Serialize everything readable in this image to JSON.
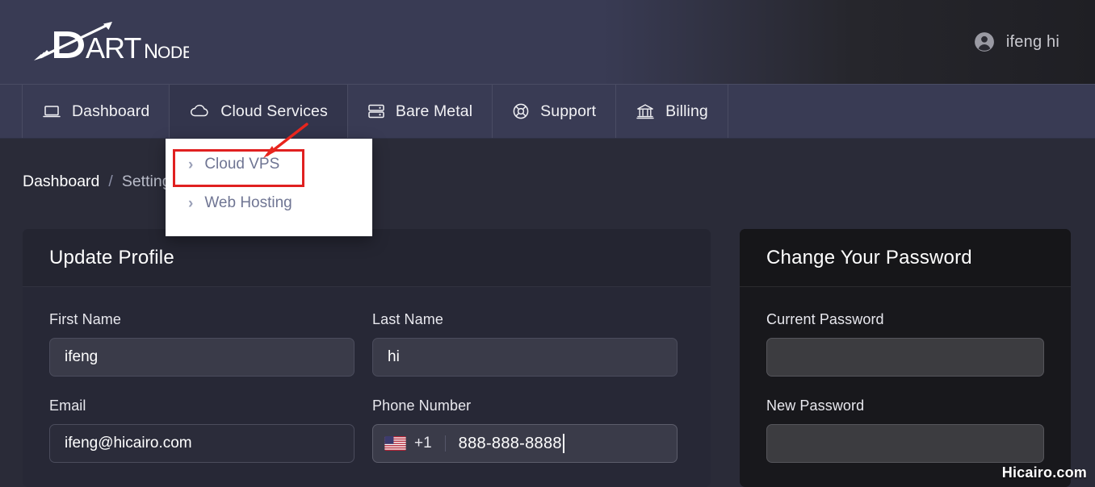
{
  "header": {
    "logo_text_main": "ART",
    "logo_text_sub": "NODE",
    "logo_alt": "DartNode",
    "user_name": "ifeng hi"
  },
  "nav": {
    "items": [
      {
        "label": "Dashboard",
        "icon": "laptop-icon",
        "active": false
      },
      {
        "label": "Cloud Services",
        "icon": "cloud-icon",
        "active": true
      },
      {
        "label": "Bare Metal",
        "icon": "server-icon",
        "active": false
      },
      {
        "label": "Support",
        "icon": "lifering-icon",
        "active": false
      },
      {
        "label": "Billing",
        "icon": "bank-icon",
        "active": false
      }
    ]
  },
  "dropdown": {
    "items": [
      {
        "label": "Cloud VPS",
        "highlighted": true
      },
      {
        "label": "Web Hosting",
        "highlighted": false
      }
    ],
    "chevron": "›",
    "highlight_color": "#e02020"
  },
  "breadcrumb": {
    "root": "Dashboard",
    "separator": "/",
    "current": "Settings"
  },
  "profile_card": {
    "title": "Update Profile",
    "first_name": {
      "label": "First Name",
      "value": "ifeng",
      "placeholder": ""
    },
    "last_name": {
      "label": "Last Name",
      "value": "hi",
      "placeholder": ""
    },
    "email": {
      "label": "Email",
      "value": "ifeng@hicairo.com",
      "placeholder": ""
    },
    "phone": {
      "label": "Phone Number",
      "country_flag": "us-flag-icon",
      "country_code": "+1",
      "value": "888-888-8888",
      "placeholder": ""
    }
  },
  "password_card": {
    "title": "Change Your Password",
    "current_password": {
      "label": "Current Password",
      "value": "",
      "placeholder": ""
    },
    "new_password": {
      "label": "New Password",
      "value": "",
      "placeholder": ""
    }
  },
  "watermark": {
    "text": "Hicairo.com"
  }
}
